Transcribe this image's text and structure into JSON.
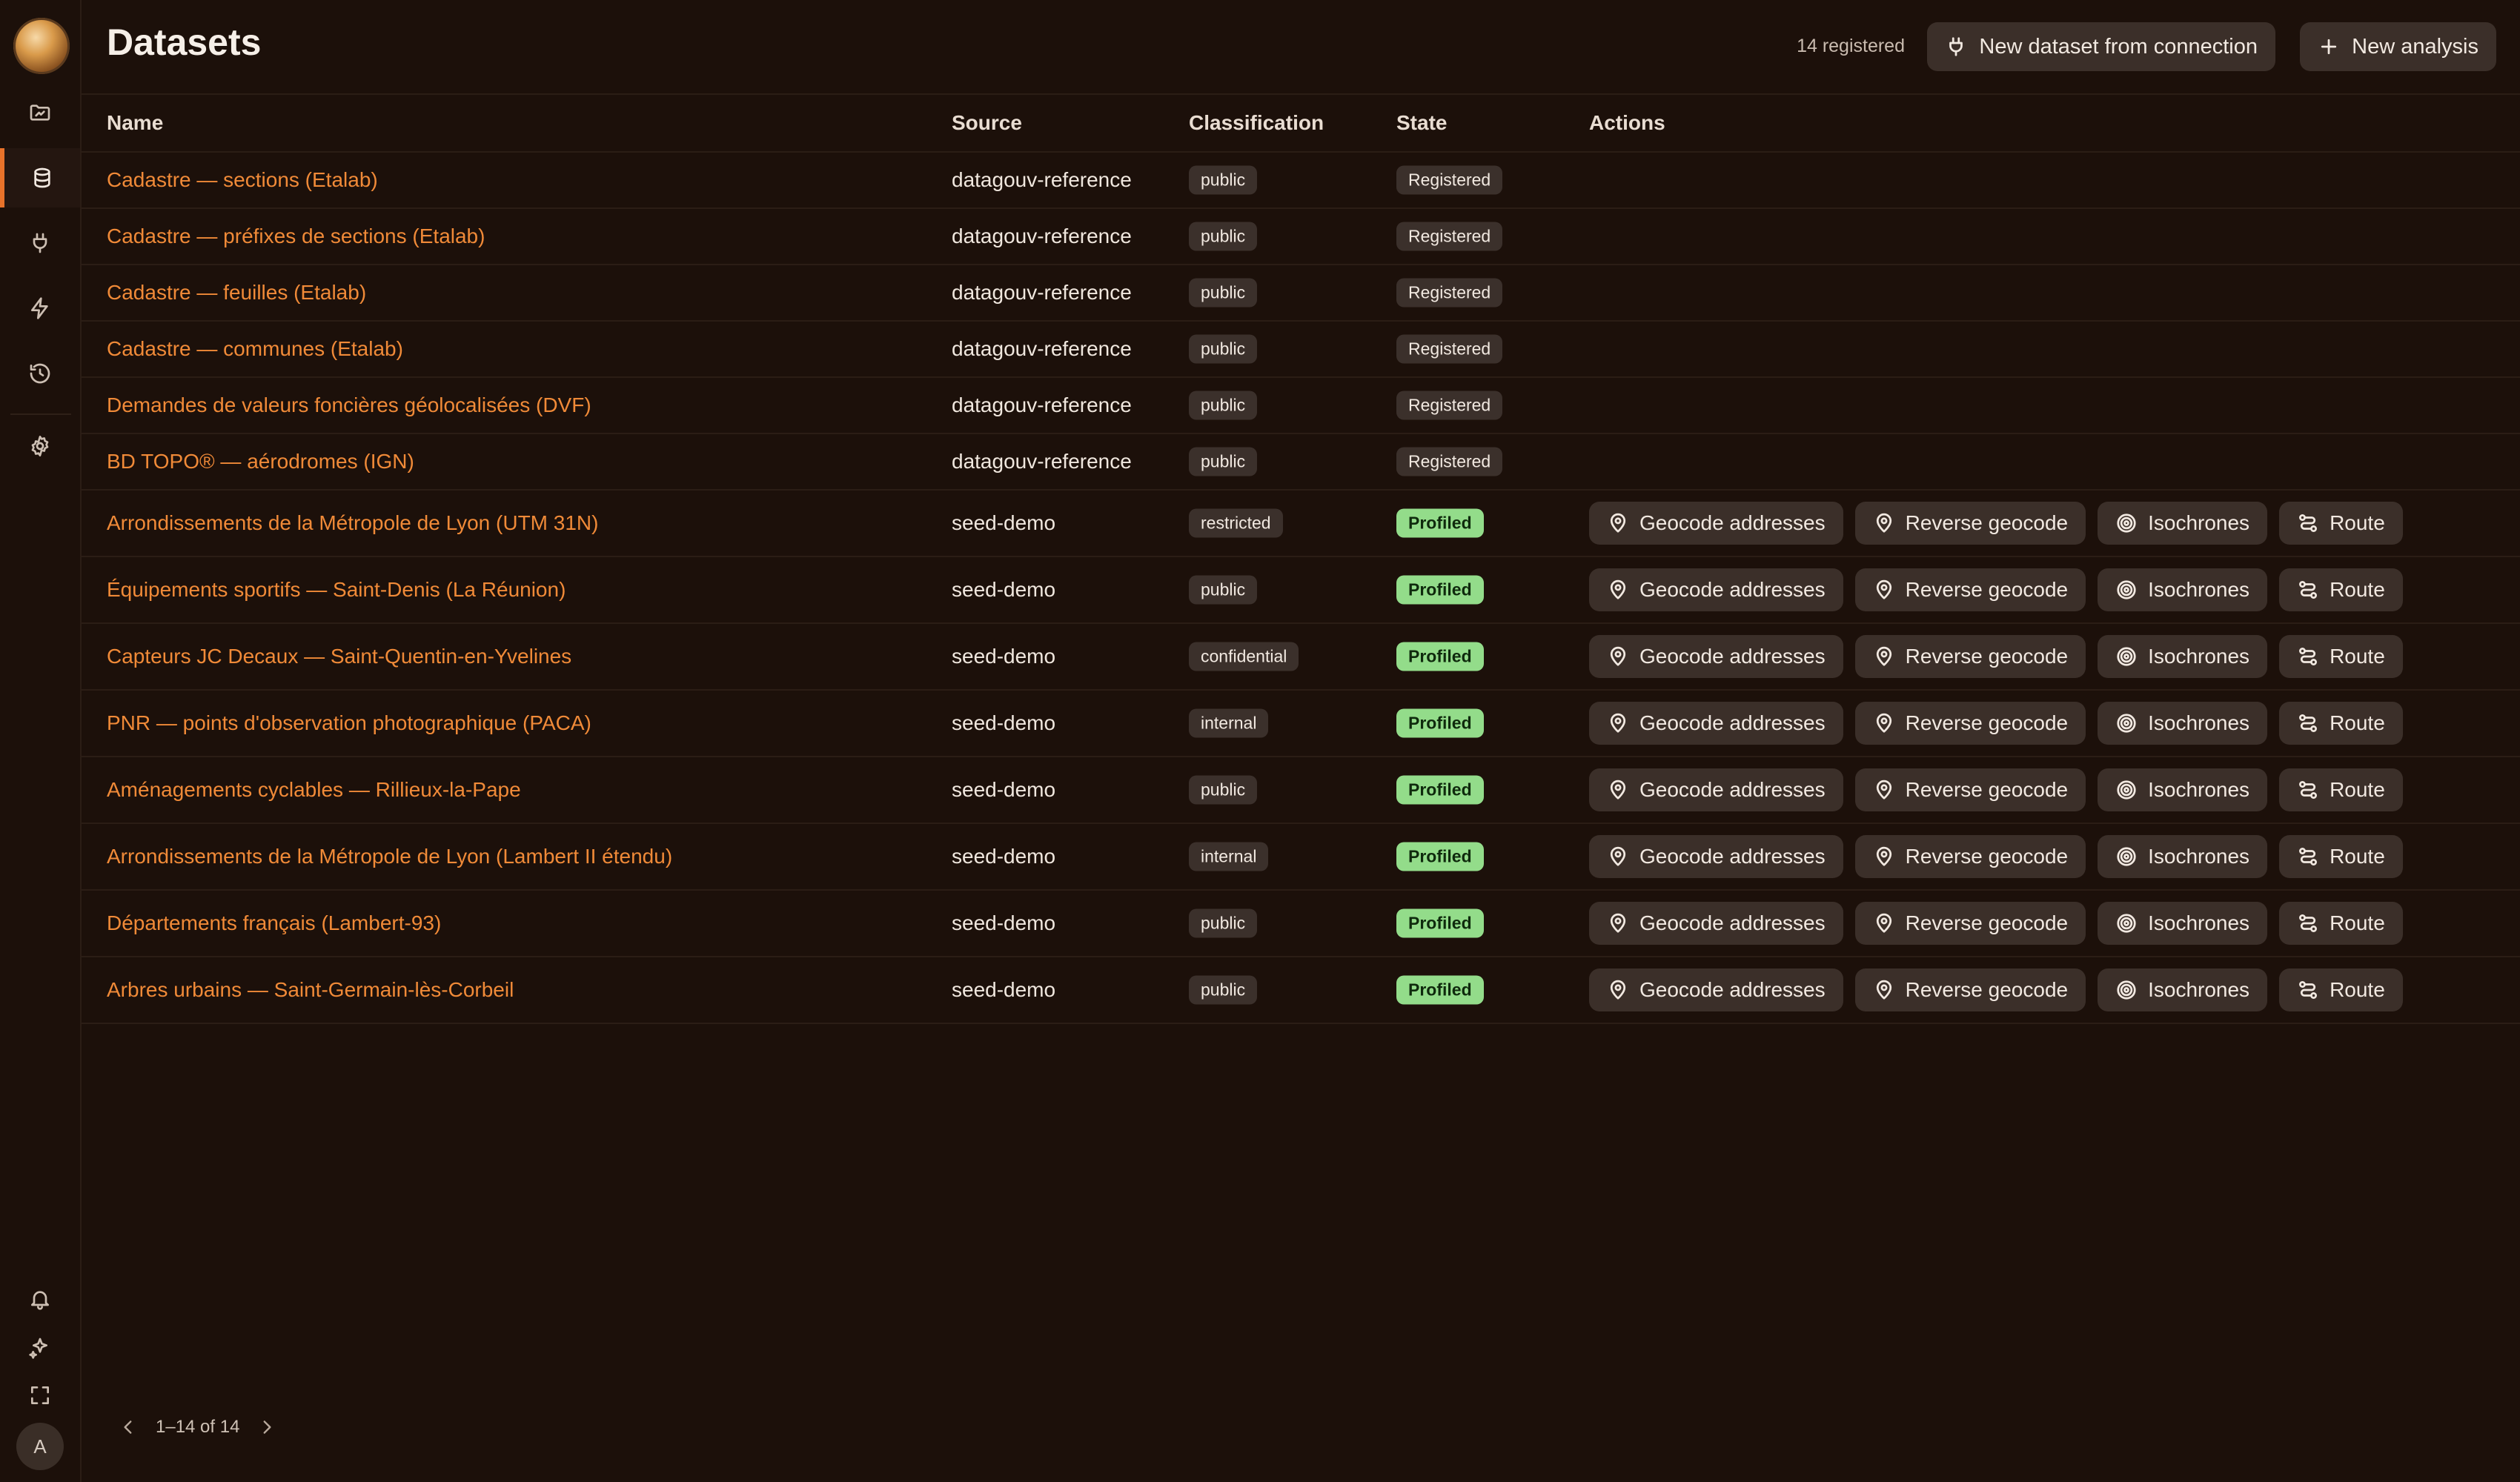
{
  "sidebar": {
    "nav": [
      {
        "name": "folder-icon",
        "active": false
      },
      {
        "name": "database-icon",
        "active": true
      },
      {
        "name": "plug-icon",
        "active": false
      },
      {
        "name": "bolt-icon",
        "active": false
      },
      {
        "name": "history-icon",
        "active": false
      },
      {
        "name": "gear-icon",
        "active": false
      }
    ],
    "bottom": [
      {
        "name": "bell-icon"
      },
      {
        "name": "sparkles-icon"
      },
      {
        "name": "fullscreen-icon"
      }
    ],
    "avatar_initial": "A"
  },
  "header": {
    "title": "Datasets",
    "registered_count": "14 registered",
    "new_dataset_label": "New dataset from connection",
    "new_analysis_label": "New analysis"
  },
  "table": {
    "columns": [
      "Name",
      "Source",
      "Classification",
      "State",
      "Actions"
    ],
    "action_labels": [
      "Geocode addresses",
      "Reverse geocode",
      "Isochrones",
      "Route"
    ],
    "rows": [
      {
        "name": "Cadastre — sections (Etalab)",
        "source": "datagouv-reference",
        "classification": "public",
        "state": "Registered"
      },
      {
        "name": "Cadastre — préfixes de sections (Etalab)",
        "source": "datagouv-reference",
        "classification": "public",
        "state": "Registered"
      },
      {
        "name": "Cadastre — feuilles (Etalab)",
        "source": "datagouv-reference",
        "classification": "public",
        "state": "Registered"
      },
      {
        "name": "Cadastre — communes (Etalab)",
        "source": "datagouv-reference",
        "classification": "public",
        "state": "Registered"
      },
      {
        "name": "Demandes de valeurs foncières géolocalisées (DVF)",
        "source": "datagouv-reference",
        "classification": "public",
        "state": "Registered"
      },
      {
        "name": "BD TOPO® — aérodromes (IGN)",
        "source": "datagouv-reference",
        "classification": "public",
        "state": "Registered"
      },
      {
        "name": "Arrondissements de la Métropole de Lyon (UTM 31N)",
        "source": "seed-demo",
        "classification": "restricted",
        "state": "Profiled"
      },
      {
        "name": "Équipements sportifs — Saint-Denis (La Réunion)",
        "source": "seed-demo",
        "classification": "public",
        "state": "Profiled"
      },
      {
        "name": "Capteurs JC Decaux — Saint-Quentin-en-Yvelines",
        "source": "seed-demo",
        "classification": "confidential",
        "state": "Profiled"
      },
      {
        "name": "PNR — points d'observation photographique (PACA)",
        "source": "seed-demo",
        "classification": "internal",
        "state": "Profiled"
      },
      {
        "name": "Aménagements cyclables — Rillieux-la-Pape",
        "source": "seed-demo",
        "classification": "public",
        "state": "Profiled"
      },
      {
        "name": "Arrondissements de la Métropole de Lyon (Lambert II étendu)",
        "source": "seed-demo",
        "classification": "internal",
        "state": "Profiled"
      },
      {
        "name": "Départements français (Lambert-93)",
        "source": "seed-demo",
        "classification": "public",
        "state": "Profiled"
      },
      {
        "name": "Arbres urbains — Saint-Germain-lès-Corbeil",
        "source": "seed-demo",
        "classification": "public",
        "state": "Profiled"
      }
    ]
  },
  "pagination": {
    "range_text": "1–14 of 14"
  },
  "colors": {
    "accent": "#e8722a",
    "link": "#f08a38",
    "profiled": "#93dc8a",
    "background": "#1c100a"
  }
}
